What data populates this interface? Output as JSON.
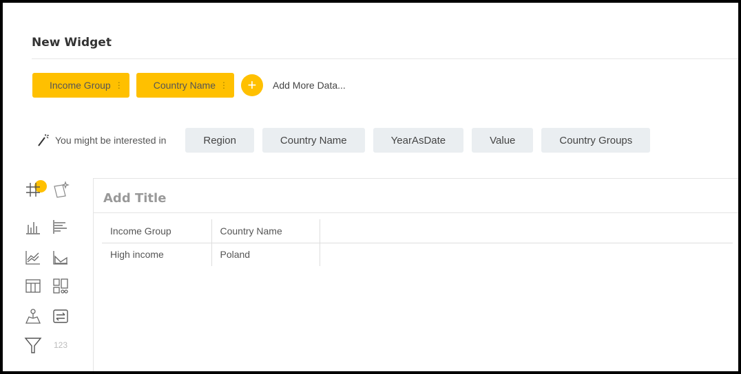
{
  "header": {
    "title": "New Widget"
  },
  "data_chips": [
    {
      "label": "Income Group",
      "menu_icon": "more-vertical-icon"
    },
    {
      "label": "Country Name",
      "menu_icon": "more-vertical-icon"
    }
  ],
  "add_more": {
    "icon": "plus-icon",
    "label": "Add More Data..."
  },
  "suggestions": {
    "icon": "magic-wand-icon",
    "label": "You might be interested in",
    "items": [
      "Region",
      "Country Name",
      "YearAsDate",
      "Value",
      "Country Groups"
    ]
  },
  "chart_types": [
    {
      "name": "table-grid-icon"
    },
    {
      "name": "smart-insights-icon"
    },
    {
      "name": "column-chart-icon"
    },
    {
      "name": "bar-chart-icon"
    },
    {
      "name": "line-chart-icon"
    },
    {
      "name": "area-chart-icon"
    },
    {
      "name": "pivot-table-icon"
    },
    {
      "name": "dashboard-layout-icon"
    },
    {
      "name": "map-pin-icon"
    },
    {
      "name": "swap-icon"
    },
    {
      "name": "funnel-icon"
    },
    {
      "name": "kpi-number-icon",
      "text": "123"
    }
  ],
  "panel": {
    "title_placeholder": "Add Title",
    "table": {
      "columns": [
        "Income Group",
        "Country Name"
      ],
      "rows": [
        [
          "High income",
          "Poland"
        ]
      ]
    }
  },
  "colors": {
    "accent": "#ffc000",
    "pill_bg": "#eaeef1",
    "frame": "#000000"
  }
}
